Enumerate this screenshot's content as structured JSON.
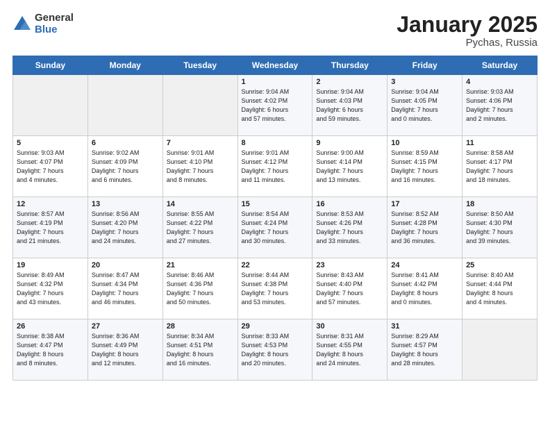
{
  "logo": {
    "general": "General",
    "blue": "Blue"
  },
  "title": "January 2025",
  "subtitle": "Pychas, Russia",
  "days_header": [
    "Sunday",
    "Monday",
    "Tuesday",
    "Wednesday",
    "Thursday",
    "Friday",
    "Saturday"
  ],
  "weeks": [
    [
      {
        "day": "",
        "info": ""
      },
      {
        "day": "",
        "info": ""
      },
      {
        "day": "",
        "info": ""
      },
      {
        "day": "1",
        "info": "Sunrise: 9:04 AM\nSunset: 4:02 PM\nDaylight: 6 hours\nand 57 minutes."
      },
      {
        "day": "2",
        "info": "Sunrise: 9:04 AM\nSunset: 4:03 PM\nDaylight: 6 hours\nand 59 minutes."
      },
      {
        "day": "3",
        "info": "Sunrise: 9:04 AM\nSunset: 4:05 PM\nDaylight: 7 hours\nand 0 minutes."
      },
      {
        "day": "4",
        "info": "Sunrise: 9:03 AM\nSunset: 4:06 PM\nDaylight: 7 hours\nand 2 minutes."
      }
    ],
    [
      {
        "day": "5",
        "info": "Sunrise: 9:03 AM\nSunset: 4:07 PM\nDaylight: 7 hours\nand 4 minutes."
      },
      {
        "day": "6",
        "info": "Sunrise: 9:02 AM\nSunset: 4:09 PM\nDaylight: 7 hours\nand 6 minutes."
      },
      {
        "day": "7",
        "info": "Sunrise: 9:01 AM\nSunset: 4:10 PM\nDaylight: 7 hours\nand 8 minutes."
      },
      {
        "day": "8",
        "info": "Sunrise: 9:01 AM\nSunset: 4:12 PM\nDaylight: 7 hours\nand 11 minutes."
      },
      {
        "day": "9",
        "info": "Sunrise: 9:00 AM\nSunset: 4:14 PM\nDaylight: 7 hours\nand 13 minutes."
      },
      {
        "day": "10",
        "info": "Sunrise: 8:59 AM\nSunset: 4:15 PM\nDaylight: 7 hours\nand 16 minutes."
      },
      {
        "day": "11",
        "info": "Sunrise: 8:58 AM\nSunset: 4:17 PM\nDaylight: 7 hours\nand 18 minutes."
      }
    ],
    [
      {
        "day": "12",
        "info": "Sunrise: 8:57 AM\nSunset: 4:19 PM\nDaylight: 7 hours\nand 21 minutes."
      },
      {
        "day": "13",
        "info": "Sunrise: 8:56 AM\nSunset: 4:20 PM\nDaylight: 7 hours\nand 24 minutes."
      },
      {
        "day": "14",
        "info": "Sunrise: 8:55 AM\nSunset: 4:22 PM\nDaylight: 7 hours\nand 27 minutes."
      },
      {
        "day": "15",
        "info": "Sunrise: 8:54 AM\nSunset: 4:24 PM\nDaylight: 7 hours\nand 30 minutes."
      },
      {
        "day": "16",
        "info": "Sunrise: 8:53 AM\nSunset: 4:26 PM\nDaylight: 7 hours\nand 33 minutes."
      },
      {
        "day": "17",
        "info": "Sunrise: 8:52 AM\nSunset: 4:28 PM\nDaylight: 7 hours\nand 36 minutes."
      },
      {
        "day": "18",
        "info": "Sunrise: 8:50 AM\nSunset: 4:30 PM\nDaylight: 7 hours\nand 39 minutes."
      }
    ],
    [
      {
        "day": "19",
        "info": "Sunrise: 8:49 AM\nSunset: 4:32 PM\nDaylight: 7 hours\nand 43 minutes."
      },
      {
        "day": "20",
        "info": "Sunrise: 8:47 AM\nSunset: 4:34 PM\nDaylight: 7 hours\nand 46 minutes."
      },
      {
        "day": "21",
        "info": "Sunrise: 8:46 AM\nSunset: 4:36 PM\nDaylight: 7 hours\nand 50 minutes."
      },
      {
        "day": "22",
        "info": "Sunrise: 8:44 AM\nSunset: 4:38 PM\nDaylight: 7 hours\nand 53 minutes."
      },
      {
        "day": "23",
        "info": "Sunrise: 8:43 AM\nSunset: 4:40 PM\nDaylight: 7 hours\nand 57 minutes."
      },
      {
        "day": "24",
        "info": "Sunrise: 8:41 AM\nSunset: 4:42 PM\nDaylight: 8 hours\nand 0 minutes."
      },
      {
        "day": "25",
        "info": "Sunrise: 8:40 AM\nSunset: 4:44 PM\nDaylight: 8 hours\nand 4 minutes."
      }
    ],
    [
      {
        "day": "26",
        "info": "Sunrise: 8:38 AM\nSunset: 4:47 PM\nDaylight: 8 hours\nand 8 minutes."
      },
      {
        "day": "27",
        "info": "Sunrise: 8:36 AM\nSunset: 4:49 PM\nDaylight: 8 hours\nand 12 minutes."
      },
      {
        "day": "28",
        "info": "Sunrise: 8:34 AM\nSunset: 4:51 PM\nDaylight: 8 hours\nand 16 minutes."
      },
      {
        "day": "29",
        "info": "Sunrise: 8:33 AM\nSunset: 4:53 PM\nDaylight: 8 hours\nand 20 minutes."
      },
      {
        "day": "30",
        "info": "Sunrise: 8:31 AM\nSunset: 4:55 PM\nDaylight: 8 hours\nand 24 minutes."
      },
      {
        "day": "31",
        "info": "Sunrise: 8:29 AM\nSunset: 4:57 PM\nDaylight: 8 hours\nand 28 minutes."
      },
      {
        "day": "",
        "info": ""
      }
    ]
  ]
}
